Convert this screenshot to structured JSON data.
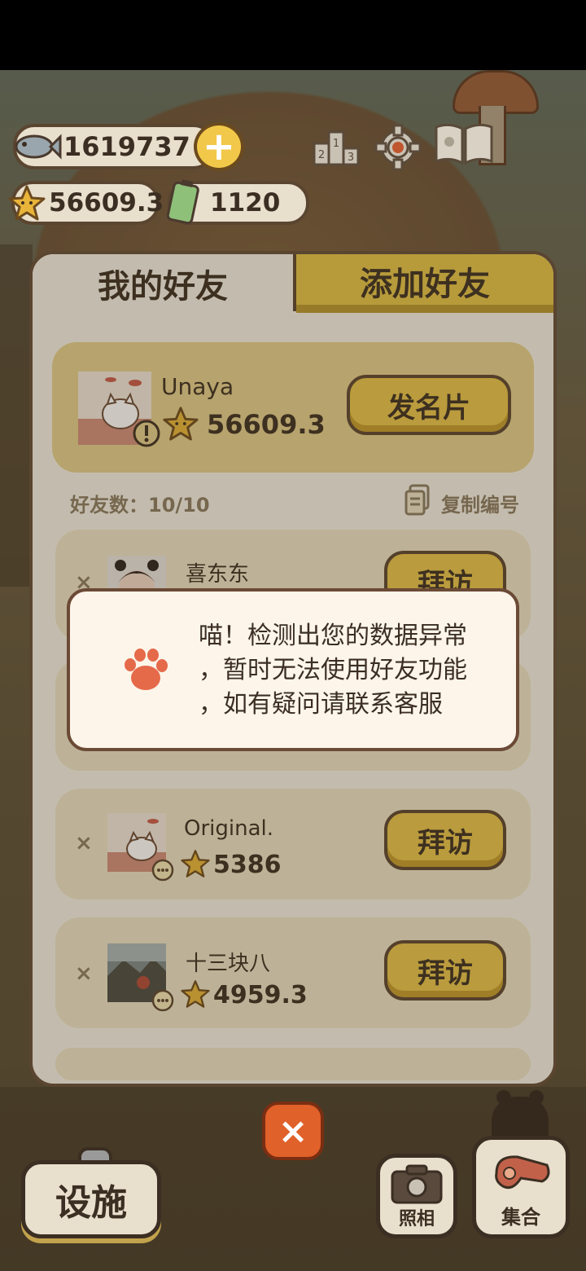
{
  "hud": {
    "fish_count": "1619737",
    "star_count": "56609.3",
    "battery_count": "1120",
    "plus_label": "+"
  },
  "tabs": {
    "my_friends": "我的好友",
    "add_friends": "添加好友"
  },
  "self": {
    "name": "Unaya",
    "score": "56609.3",
    "card_button": "发名片"
  },
  "friends_meta": {
    "count_label": "好友数：10/10",
    "copy_label": "复制编号"
  },
  "friends": [
    {
      "name": "喜东东",
      "score": "",
      "visit": "拜访",
      "remove": "×"
    },
    {
      "name": "",
      "score": "",
      "visit": "",
      "remove": ""
    },
    {
      "name": "Original.",
      "score": "5386",
      "visit": "拜访",
      "remove": "×"
    },
    {
      "name": "十三块八",
      "score": "4959.3",
      "visit": "拜访",
      "remove": "×"
    }
  ],
  "dialog": {
    "lines": [
      "喵！检测出您的数据异常",
      "，暂时无法使用好友功能",
      "，如有疑问请联系客服"
    ]
  },
  "bottom": {
    "close": "×",
    "facility": "设施",
    "photo": "照相",
    "gather": "集合"
  },
  "colors": {
    "accent_gold": "#e8c24a",
    "panel": "#f4f0e6",
    "close_orange": "#e0612a",
    "paw": "#e56a4a"
  }
}
